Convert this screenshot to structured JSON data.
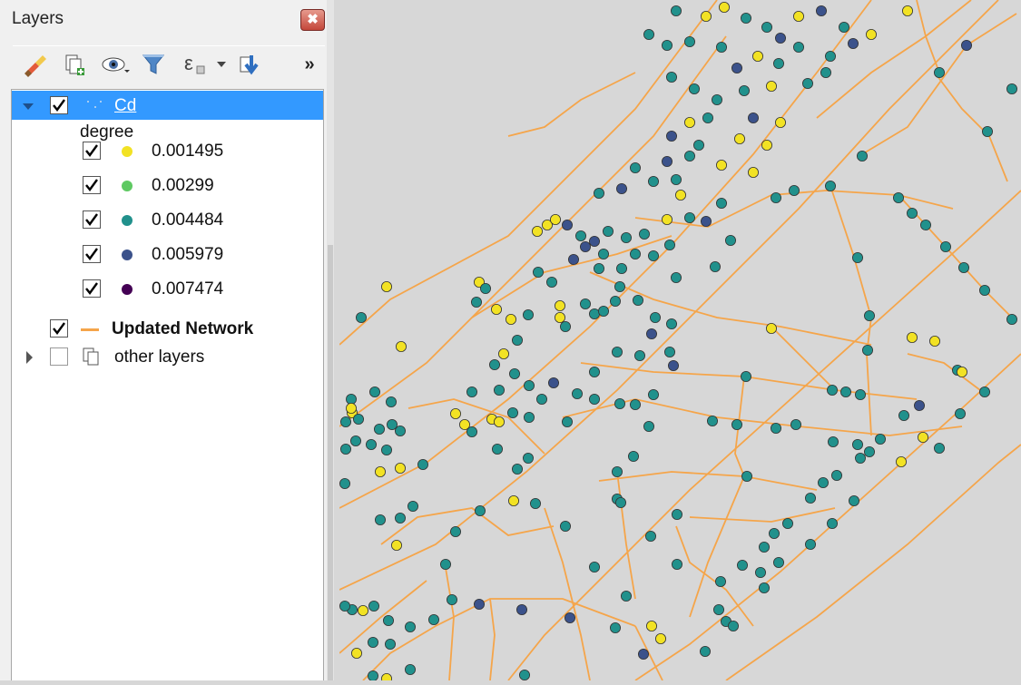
{
  "panel": {
    "title": "Layers",
    "close_symbol": "✖",
    "toolbar_overflow": "»"
  },
  "layers": {
    "cd": {
      "name": "Cd",
      "checked": true,
      "expanded": true,
      "attribute": "degree",
      "classes": [
        {
          "label": "0.001495",
          "color": "#f2e224",
          "checked": true
        },
        {
          "label": "0.00299",
          "color": "#5ec962",
          "checked": true
        },
        {
          "label": "0.004484",
          "color": "#21918c",
          "checked": true
        },
        {
          "label": "0.005979",
          "color": "#3b528b",
          "checked": true
        },
        {
          "label": "0.007474",
          "color": "#440154",
          "checked": true
        }
      ]
    },
    "network": {
      "name": "Updated Network",
      "checked": true,
      "line_color": "#f5a54a"
    },
    "group": {
      "name": "other layers",
      "checked": false,
      "expanded": false
    }
  },
  "map": {
    "background": "#d7d7d7",
    "line_color": "#f5a54a"
  }
}
